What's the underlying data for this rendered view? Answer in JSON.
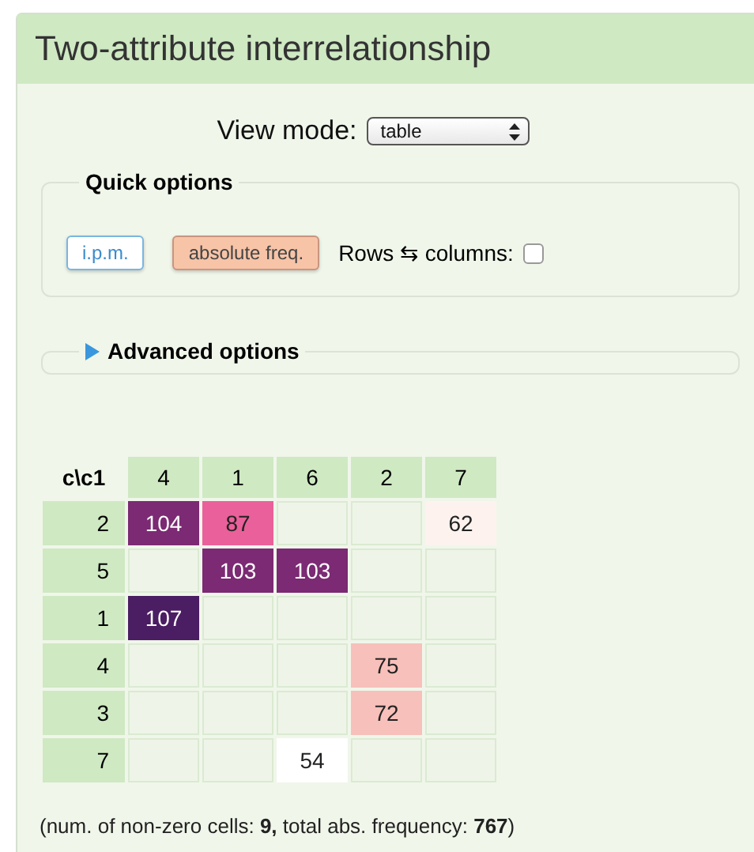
{
  "panel": {
    "title": "Two-attribute interrelationship"
  },
  "view_mode": {
    "label": "View mode:",
    "value": "table"
  },
  "quick_options": {
    "legend": "Quick options",
    "buttons": [
      {
        "label": "i.p.m.",
        "selected": false
      },
      {
        "label": "absolute freq.",
        "selected": true
      }
    ],
    "swap": {
      "label": "Rows ⇆ columns:",
      "checked": false
    }
  },
  "advanced_options": {
    "label": "Advanced options",
    "expanded": false
  },
  "table": {
    "corner": "c\\c1",
    "columns": [
      "4",
      "1",
      "6",
      "2",
      "7"
    ],
    "rows": [
      {
        "header": "2",
        "cells": [
          {
            "value": "104",
            "color": "#7b2a73"
          },
          {
            "value": "87",
            "color": "#ea609a"
          },
          {},
          {},
          {
            "value": "62",
            "color": "#fdf2ee"
          }
        ]
      },
      {
        "header": "5",
        "cells": [
          {},
          {
            "value": "103",
            "color": "#7b2a73"
          },
          {
            "value": "103",
            "color": "#7b2a73"
          },
          {},
          {}
        ]
      },
      {
        "header": "1",
        "cells": [
          {
            "value": "107",
            "color": "#4b1d63"
          },
          {},
          {},
          {},
          {}
        ]
      },
      {
        "header": "4",
        "cells": [
          {},
          {},
          {},
          {
            "value": "75",
            "color": "#f7c0ba"
          },
          {}
        ]
      },
      {
        "header": "3",
        "cells": [
          {},
          {},
          {},
          {
            "value": "72",
            "color": "#f7c0ba"
          },
          {}
        ]
      },
      {
        "header": "7",
        "cells": [
          {},
          {},
          {
            "value": "54",
            "color": "#ffffff"
          },
          {},
          {}
        ]
      }
    ]
  },
  "summary": "(num. of non-zero cells: **9,** total abs. frequency: **767**)"
}
